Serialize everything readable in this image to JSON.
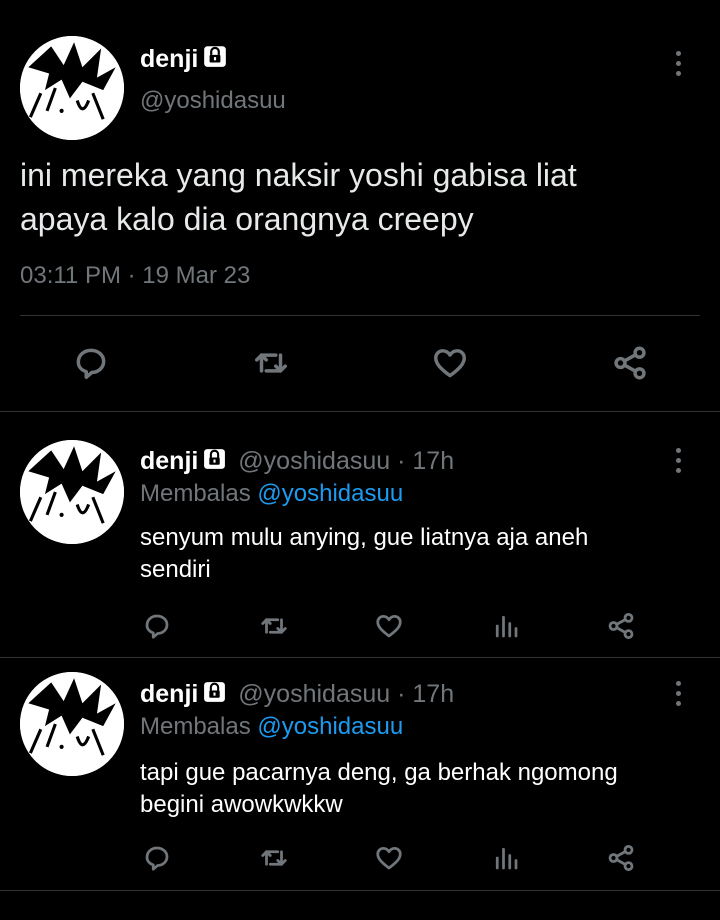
{
  "main_tweet": {
    "display_name": "denji",
    "handle": "@yoshidasuu",
    "text_line1": "ini mereka yang naksir yoshi gabisa liat",
    "text_line2": "apaya kalo dia orangnya creepy",
    "timestamp": "03:11 PM · 19 Mar 23",
    "actions": [
      "reply-icon",
      "retweet-icon",
      "like-icon",
      "share-icon"
    ]
  },
  "replies": [
    {
      "display_name": "denji",
      "handle": "@yoshidasuu",
      "age": "· 17h",
      "replying_label": "Membalas",
      "replying_to": "@yoshidasuu",
      "text_line1": "senyum mulu anying, gue liatnya aja aneh",
      "text_line2": "sendiri"
    },
    {
      "display_name": "denji",
      "handle": "@yoshidasuu",
      "age": "· 17h",
      "replying_label": "Membalas",
      "replying_to": "@yoshidasuu",
      "text_line1": "tapi gue pacarnya deng, ga berhak ngomong",
      "text_line2": "begini awowkwkkw"
    }
  ],
  "colors": {
    "background": "#000000",
    "text": "#e7e9ea",
    "muted": "#71767b",
    "accent": "#1d9bf0",
    "divider": "#2f3336"
  }
}
